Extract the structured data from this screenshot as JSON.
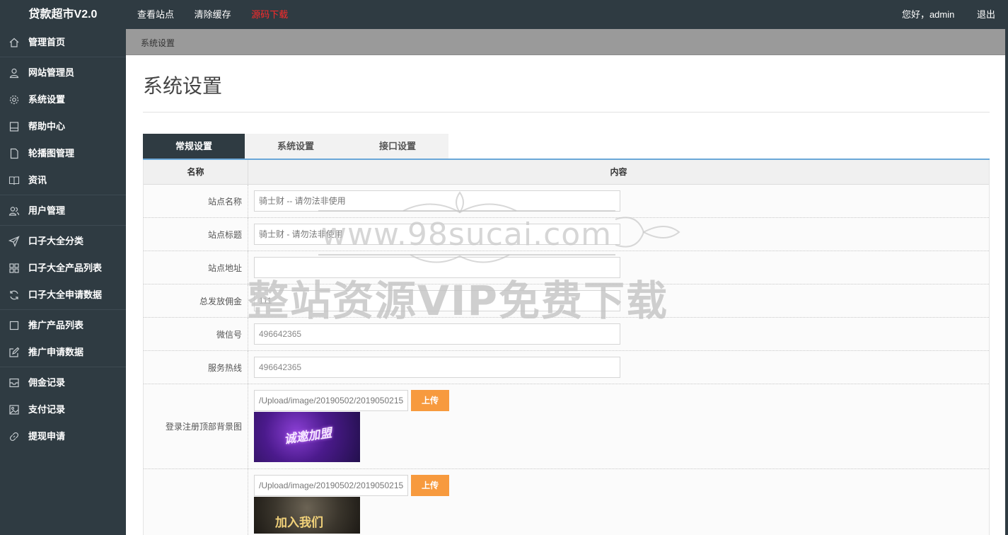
{
  "header": {
    "brand": "贷款超市V2.0",
    "nav": [
      "查看站点",
      "清除缓存",
      "源码下载"
    ],
    "greeting": "您好，admin",
    "logout": "退出"
  },
  "sidebar": {
    "groups": [
      [
        {
          "label": "管理首页",
          "icon": "home-icon"
        }
      ],
      [
        {
          "label": "网站管理员",
          "icon": "user-icon"
        },
        {
          "label": "系统设置",
          "icon": "gear-icon"
        },
        {
          "label": "帮助中心",
          "icon": "book-icon"
        },
        {
          "label": "轮播图管理",
          "icon": "file-icon"
        },
        {
          "label": "资讯",
          "icon": "open-book-icon"
        }
      ],
      [
        {
          "label": "用户管理",
          "icon": "users-icon"
        }
      ],
      [
        {
          "label": "口子大全分类",
          "icon": "send-icon"
        },
        {
          "label": "口子大全产品列表",
          "icon": "grid-icon"
        },
        {
          "label": "口子大全申请数据",
          "icon": "refresh-icon"
        }
      ],
      [
        {
          "label": "推广产品列表",
          "icon": "square-icon"
        },
        {
          "label": "推广申请数据",
          "icon": "edit-icon"
        }
      ],
      [
        {
          "label": "佣金记录",
          "icon": "inbox-icon"
        },
        {
          "label": "支付记录",
          "icon": "image-icon"
        },
        {
          "label": "提现申请",
          "icon": "link-icon"
        }
      ]
    ]
  },
  "breadcrumb": "系统设置",
  "page_title": "系统设置",
  "tabs": [
    "常规设置",
    "系统设置",
    "接口设置"
  ],
  "table": {
    "headers": [
      "名称",
      "内容"
    ],
    "fields": [
      {
        "label": "站点名称",
        "value": "",
        "placeholder": "骑士财 -- 请勿法非使用"
      },
      {
        "label": "站点标题",
        "value": "",
        "placeholder": "骑士财 - 请勿法非使用"
      },
      {
        "label": "站点地址",
        "value": "",
        "placeholder": ""
      },
      {
        "label": "总发放佣金",
        "value": "111",
        "placeholder": ""
      },
      {
        "label": "微信号",
        "value": "496642365",
        "placeholder": ""
      },
      {
        "label": "服务热线",
        "value": "496642365",
        "placeholder": ""
      }
    ],
    "uploads": [
      {
        "label": "登录注册顶部背景图",
        "path": "/Upload/image/20190502/2019050215",
        "button": "上传",
        "thumb_text": "诚邀加盟"
      },
      {
        "label": "",
        "path": "/Upload/image/20190502/2019050215",
        "button": "上传",
        "thumb_text": "加入我们"
      }
    ]
  },
  "watermark": {
    "url": "www.98sucai.com",
    "text": "整站资源VIP免费下载"
  },
  "colors": {
    "dark": "#2f3b42",
    "accent_orange": "#f79a3e",
    "tab_line": "#6aa7d8",
    "nav_red": "#ff2a2a"
  }
}
